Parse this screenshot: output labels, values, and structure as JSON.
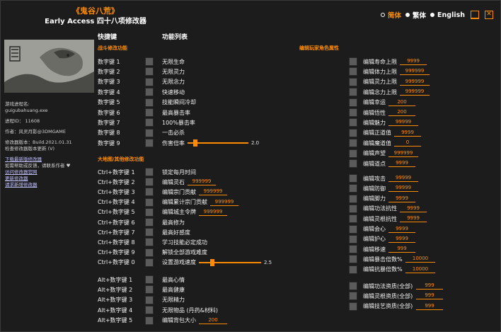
{
  "title": {
    "line1": "《鬼谷八荒》",
    "line2": "Early Access 四十八项修改器"
  },
  "languages": [
    {
      "label": "简体",
      "active": true
    },
    {
      "label": "繁体",
      "active": false
    },
    {
      "label": "English",
      "active": false
    }
  ],
  "headers": {
    "hotkeys": "快捷键",
    "functions": "功能列表"
  },
  "sections": {
    "combat": "战斗修改功能",
    "world": "大地图/其他修改功能",
    "player": "编辑玩家角色属性"
  },
  "game_info": {
    "process_name_label": "游戏进程名:",
    "process_name": "guigubahuang.exe",
    "pid": "进程ID： 11608",
    "author": "作者：风灵月影@3DMGAME",
    "version": "修改器版本：Build.2021.01.31",
    "check_update": "检查修改器版本更新 (V)",
    "links": [
      "下载最新版修改器",
      "访问修改器官网",
      "更新修改器",
      "请求新增修改器"
    ],
    "thanks": "如需帮助或反馈，请联系作者 ♥"
  },
  "combat": [
    {
      "key": "数字键 1",
      "label": "无限生命"
    },
    {
      "key": "数字键 2",
      "label": "无限灵力"
    },
    {
      "key": "数字键 3",
      "label": "无限念力"
    },
    {
      "key": "数字键 4",
      "label": "快速移动"
    },
    {
      "key": "数字键 5",
      "label": "技能瞬间冷却"
    },
    {
      "key": "数字键 6",
      "label": "最高暴击率"
    },
    {
      "key": "数字键 7",
      "label": "100%暴击率"
    },
    {
      "key": "数字键 8",
      "label": "一击必杀"
    },
    {
      "key": "数字键 9",
      "label": "伤害倍率",
      "slider": "2.0",
      "slider_level": 0.1
    }
  ],
  "world": [
    {
      "key": "Ctrl+数字键 1",
      "label": "锁定每月时间"
    },
    {
      "key": "Ctrl+数字键 2",
      "label": "编辑灵石",
      "value": "999999"
    },
    {
      "key": "Ctrl+数字键 3",
      "label": "编辑宗门贡献",
      "value": "999999"
    },
    {
      "key": "Ctrl+数字键 4",
      "label": "编辑累计宗门贡献",
      "value": "999999"
    },
    {
      "key": "Ctrl+数字键 5",
      "label": "编辑城主令牌",
      "value": "999999"
    },
    {
      "key": "Ctrl+数字键 6",
      "label": "最高修为"
    },
    {
      "key": "Ctrl+数字键 7",
      "label": "最高好感度"
    },
    {
      "key": "Ctrl+数字键 8",
      "label": "学习技能必定成功"
    },
    {
      "key": "Ctrl+数字键 9",
      "label": "解锁全部游戏难度"
    },
    {
      "key": "Ctrl+数字键 0",
      "label": "设置游戏速度",
      "slider": "2.5",
      "slider_level": 0.2
    },
    {
      "key": "Alt+数字键 1",
      "label": "最高心情"
    },
    {
      "key": "Alt+数字键 2",
      "label": "最高健康"
    },
    {
      "key": "Alt+数字键 3",
      "label": "无限精力"
    },
    {
      "key": "Alt+数字键 4",
      "label": "无限物品 (丹药&材料)"
    },
    {
      "key": "Alt+数字键 5",
      "label": "编辑背包大小",
      "value": "200"
    }
  ],
  "player": [
    {
      "label": "编辑寿命上限",
      "value": "9999"
    },
    {
      "label": "编辑体力上限",
      "value": "999999"
    },
    {
      "label": "编辑灵力上限",
      "value": "999999"
    },
    {
      "label": "编辑念力上限",
      "value": "999999"
    },
    {
      "label": "编辑幸运",
      "value": "200"
    },
    {
      "label": "编辑悟性",
      "value": "200"
    },
    {
      "label": "编辑魅力",
      "value": "99999"
    },
    {
      "label": "编辑正道值",
      "value": "9999"
    },
    {
      "label": "编辑魔道值",
      "value": "0"
    },
    {
      "label": "编辑声望",
      "value": "999999"
    },
    {
      "label": "编辑道点",
      "value": "9999"
    },
    {
      "label": "编辑攻击",
      "value": "99999"
    },
    {
      "label": "编辑防御",
      "value": "99999"
    },
    {
      "label": "编辑脚力",
      "value": "9999"
    },
    {
      "label": "编辑功法抗性",
      "value": "9999"
    },
    {
      "label": "编辑灵根抗性",
      "value": "9999"
    },
    {
      "label": "编辑会心",
      "value": "9999"
    },
    {
      "label": "编辑护心",
      "value": "9999"
    },
    {
      "label": "编辑移速",
      "value": "999"
    },
    {
      "label": "编辑暴击倍数%",
      "value": "10000"
    },
    {
      "label": "编辑抗暴倍数%",
      "value": "10000"
    },
    {
      "label": "编辑功法资质(全部)",
      "value": "999"
    },
    {
      "label": "编辑灵根资质(全部)",
      "value": "999"
    },
    {
      "label": "编辑技艺资质(全部)",
      "value": "999"
    }
  ],
  "colors": {
    "accent": "#ff8c00",
    "background": "#1c1c1c",
    "checkbox": "#5b5b5b"
  }
}
